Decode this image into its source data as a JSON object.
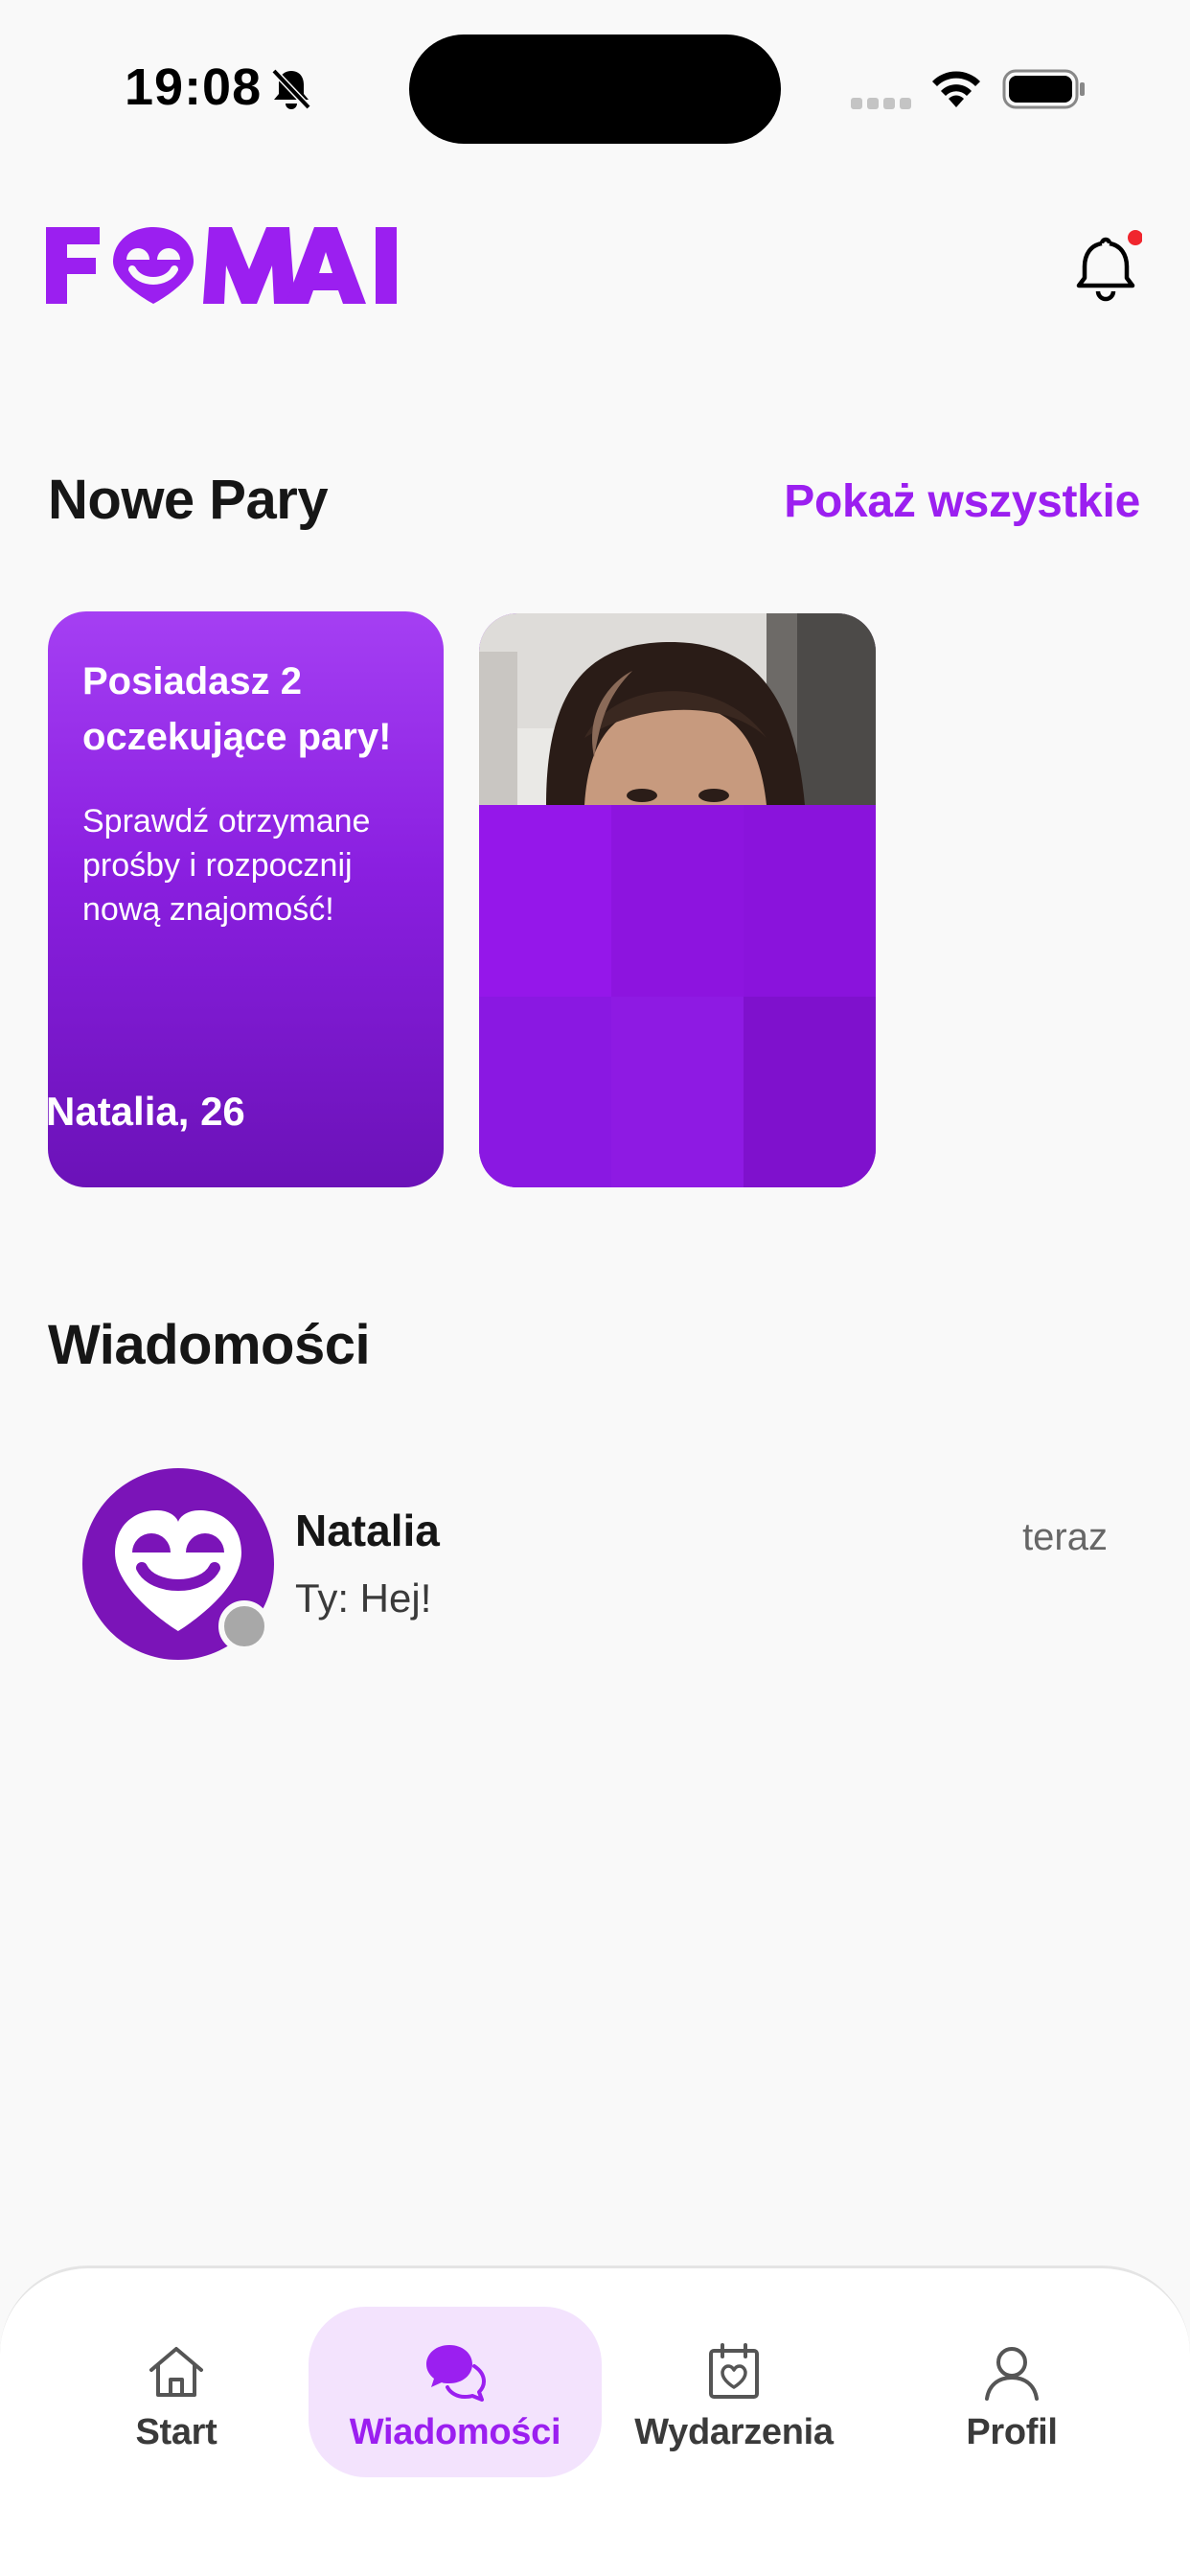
{
  "status_bar": {
    "time": "19:08"
  },
  "header": {
    "logo_text": "FEMAI",
    "brand_color": "#9b1ff0",
    "notification_dot_color": "#f0262e"
  },
  "new_pairs": {
    "title": "Nowe Pary",
    "show_all_label": "Pokaż wszystkie",
    "pending_card": {
      "title": "Posiadasz 2 oczekujące pary!",
      "text": "Sprawdź otrzymane prośby i rozpocznij nową znajomość!"
    },
    "match_card": {
      "name": "Natalia, 26"
    }
  },
  "messages": {
    "title": "Wiadomości",
    "conversations": [
      {
        "name": "Natalia",
        "preview": "Ty: Hej!",
        "time": "teraz"
      }
    ]
  },
  "tab_bar": {
    "items": [
      {
        "label": "Start",
        "icon": "home-icon"
      },
      {
        "label": "Wiadomości",
        "icon": "chat-bubbles-icon",
        "active": true
      },
      {
        "label": "Wydarzenia",
        "icon": "calendar-heart-icon"
      },
      {
        "label": "Profil",
        "icon": "user-icon"
      }
    ]
  }
}
